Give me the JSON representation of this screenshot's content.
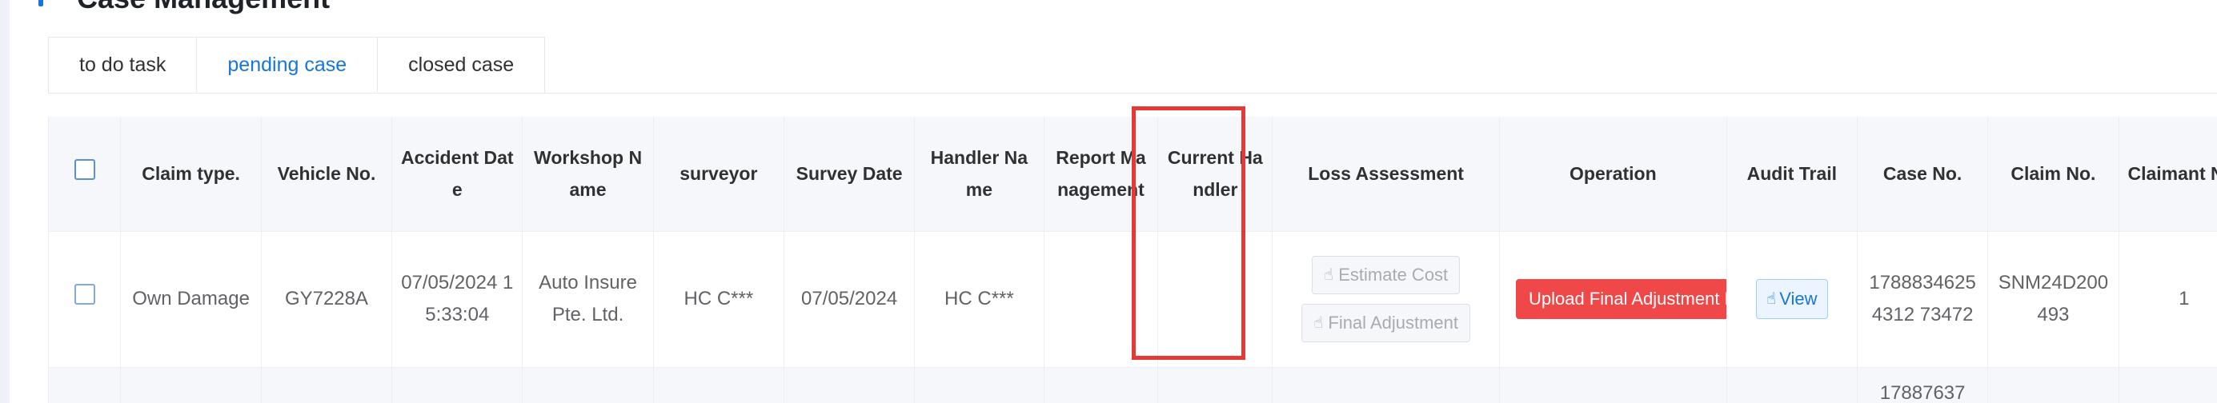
{
  "page": {
    "title": "Case Management"
  },
  "tabs": [
    {
      "label": "to do task",
      "active": false
    },
    {
      "label": "pending case",
      "active": true
    },
    {
      "label": "closed case",
      "active": false
    }
  ],
  "table": {
    "headers": {
      "claim_type": "Claim type.",
      "vehicle_no": "Vehicle No.",
      "accident_date": "Accident Date",
      "workshop_name": "Workshop Name",
      "surveyor": "surveyor",
      "survey_date": "Survey Date",
      "handler_name": "Handler Name",
      "report_management": "Report Management",
      "current_handler": "Current Handler",
      "loss_assessment": "Loss Assessment",
      "operation": "Operation",
      "audit_trail": "Audit Trail",
      "case_no": "Case No.",
      "claim_no": "Claim No.",
      "claimant_no": "Claimant No."
    },
    "rows": [
      {
        "claim_type": "Own Damage",
        "vehicle_no": "GY7228A",
        "accident_date": "07/05/2024 15:33:04",
        "workshop_name": "Auto Insure Pte. Ltd.",
        "surveyor": "HC C***",
        "survey_date": "07/05/2024",
        "handler_name": "HC C***",
        "report_management": "",
        "current_handler": "",
        "loss_estimate_label": "Estimate Cost",
        "loss_final_label": "Final Adjustment",
        "operation_label": "Upload Final Adjustment Report",
        "audit_label": "View",
        "case_no": "17888346254312 73472",
        "claim_no": "SNM24D200493",
        "claimant_no": "1"
      },
      {
        "case_no": "17887637"
      }
    ]
  },
  "colors": {
    "accent": "#1677d9",
    "danger": "#f04848",
    "highlight": "#e53935"
  },
  "icons": {
    "hand": "hand-pointer-icon"
  }
}
